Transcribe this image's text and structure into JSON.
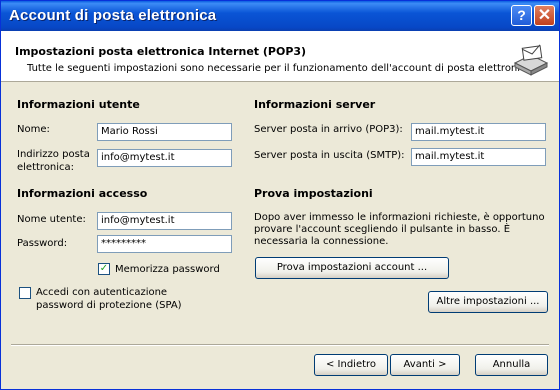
{
  "window": {
    "title": "Account di posta elettronica"
  },
  "titlebar_buttons": {
    "help": "?",
    "close": "✕"
  },
  "header": {
    "title": "Impostazioni posta elettronica Internet (POP3)",
    "subtitle": "Tutte le seguenti impostazioni sono necessarie per il funzionamento dell'account di posta elettronica."
  },
  "user_info": {
    "section": "Informazioni utente",
    "name_label": "Nome:",
    "name_value": "Mario Rossi",
    "email_label_1": "Indirizzo posta",
    "email_label_2": "elettronica:",
    "email_value": "info@mytest.it"
  },
  "server_info": {
    "section": "Informazioni server",
    "incoming_label": "Server posta in arrivo (POP3):",
    "incoming_value": "mail.mytest.it",
    "outgoing_label": "Server posta in uscita (SMTP):",
    "outgoing_value": "mail.mytest.it"
  },
  "access_info": {
    "section": "Informazioni accesso",
    "username_label": "Nome utente:",
    "username_value": "info@mytest.it",
    "password_label": "Password:",
    "password_value": "*********",
    "remember_label": "Memorizza password",
    "remember_checked": true,
    "spa_label_1": "Accedi con autenticazione",
    "spa_label_2": "password di protezione (SPA)",
    "spa_checked": false
  },
  "test_settings": {
    "section": "Prova impostazioni",
    "desc_1": "Dopo aver immesso le informazioni richieste, è opportuno",
    "desc_2": "provare l'account scegliendo il pulsante in basso. È",
    "desc_3": "necessaria la connessione.",
    "test_button": "Prova impostazioni account ..."
  },
  "more_settings_button": "Altre impostazioni ...",
  "nav": {
    "back": "< Indietro",
    "next": "Avanti >",
    "cancel": "Annulla"
  },
  "check_glyph": "✓",
  "icons": {
    "header": "mail-account-icon",
    "help": "help-icon",
    "close": "close-icon"
  }
}
